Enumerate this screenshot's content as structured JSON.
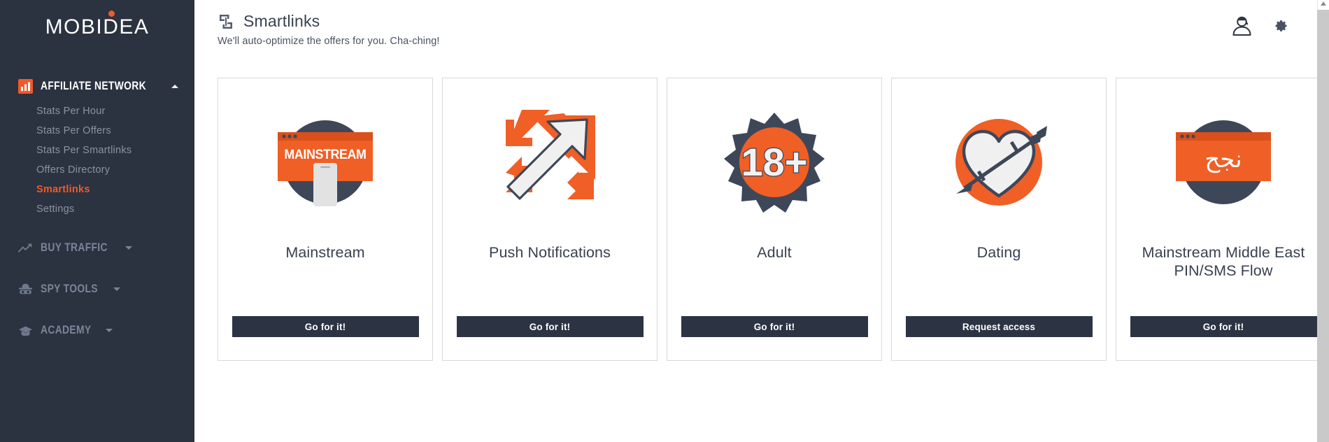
{
  "brand": {
    "logo_text": "MOBIDEA",
    "accent_color": "#f2592a",
    "sidebar_color": "#2b3240",
    "dark_color": "#2c3444"
  },
  "sidebar": {
    "groups": [
      {
        "label": "AFFILIATE NETWORK",
        "icon": "bar-chart-icon",
        "expanded": true,
        "items": [
          {
            "label": "Stats Per Hour",
            "selected": false
          },
          {
            "label": "Stats Per Offers",
            "selected": false
          },
          {
            "label": "Stats Per Smartlinks",
            "selected": false
          },
          {
            "label": "Offers Directory",
            "selected": false
          },
          {
            "label": "Smartlinks",
            "selected": true
          },
          {
            "label": "Settings",
            "selected": false
          }
        ]
      },
      {
        "label": "BUY TRAFFIC",
        "icon": "trending-up-icon",
        "expanded": false,
        "items": []
      },
      {
        "label": "SPY TOOLS",
        "icon": "spy-hat-icon",
        "expanded": false,
        "items": []
      },
      {
        "label": "ACADEMY",
        "icon": "graduation-cap-icon",
        "expanded": false,
        "items": []
      }
    ]
  },
  "header": {
    "icon": "link-chain-icon",
    "title": "Smartlinks",
    "subtitle": "We'll auto-optimize the offers for you. Cha-ching!",
    "right_icons": [
      {
        "name": "user-account-icon"
      },
      {
        "name": "gear-settings-icon"
      }
    ]
  },
  "cards": [
    {
      "title": "Mainstream",
      "button": "Go for it!",
      "art": "mainstream-browser-icon",
      "art_label": "MAINSTREAM"
    },
    {
      "title": "Push Notifications",
      "button": "Go for it!",
      "art": "push-arrows-icon",
      "art_label": ""
    },
    {
      "title": "Adult",
      "button": "Go for it!",
      "art": "adult-18plus-badge-icon",
      "art_label": "18+"
    },
    {
      "title": "Dating",
      "button": "Request access",
      "art": "heart-arrow-icon",
      "art_label": ""
    },
    {
      "title": "Mainstream Middle East PIN/SMS Flow",
      "button": "Go for it!",
      "art": "arabic-browser-icon",
      "art_label": "نجح"
    }
  ]
}
